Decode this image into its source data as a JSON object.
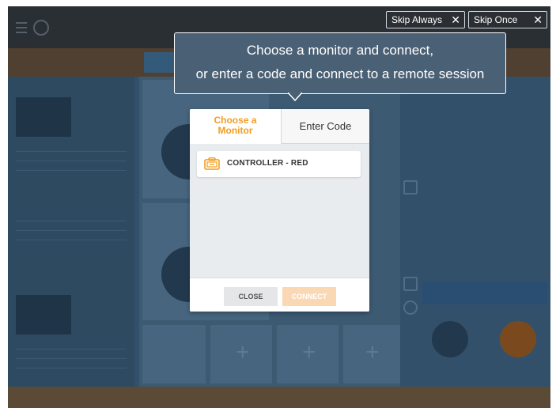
{
  "skip": {
    "always_label": "Skip Always",
    "once_label": "Skip Once",
    "close_glyph": "✕"
  },
  "callout": {
    "line1": "Choose a monitor and connect,",
    "line2": "or enter a code and connect to a remote session"
  },
  "dialog": {
    "tabs": {
      "choose_line1": "Choose a",
      "choose_line2": "Monitor",
      "enter_code": "Enter Code"
    },
    "monitors": [
      {
        "label": "CONTROLLER - RED",
        "icon": "controller-icon"
      }
    ],
    "buttons": {
      "close": "CLOSE",
      "connect": "CONNECT"
    }
  },
  "colors": {
    "accent_orange": "#f39c1f",
    "connect_disabled": "#fbd8b4",
    "overlay_blue": "#33506b"
  }
}
